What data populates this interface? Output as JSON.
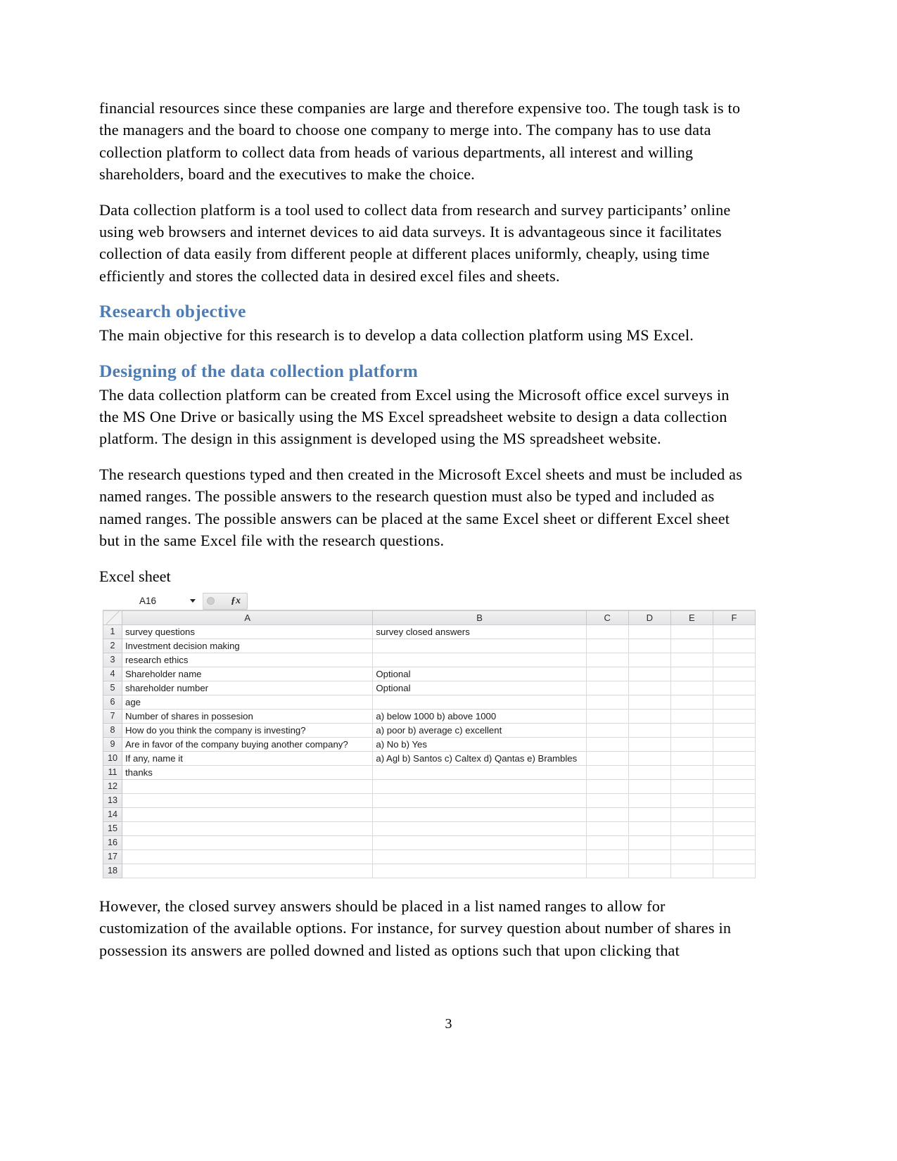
{
  "document": {
    "page_number": "3",
    "paragraphs": [
      "financial resources since these companies are large and therefore expensive too. The tough task is to the managers and the board to choose one company to merge into. The company has to use data collection platform to collect data from heads of various departments, all interest and willing shareholders, board and the executives to make the choice.",
      "Data collection platform is a tool used to collect data from research and survey participants’ online using web browsers and internet devices to aid data surveys.  It is advantageous since it facilitates collection of data easily from different people at different places uniformly, cheaply, using time efficiently and stores the collected data in desired excel files and sheets."
    ],
    "heading_1": "Research objective",
    "heading_1_body": "The main objective for this research is to develop a data collection platform using MS Excel.",
    "heading_2": "Designing of the data collection platform",
    "heading_2_body": "The data collection platform can be created from Excel using the Microsoft office excel surveys in the MS One Drive or basically using the MS Excel spreadsheet website to design a data collection platform. The design in this assignment is developed using the MS spreadsheet website.",
    "paragraph_after": "The research questions typed and then created in the Microsoft Excel sheets and must be included as named ranges. The possible answers to the research question must also be typed and included as named ranges. The possible answers can be placed at the same Excel sheet or different Excel sheet but in the same Excel file with the research questions.",
    "figure_caption": "Excel sheet",
    "closing_paragraph": "However, the closed survey answers should be placed in a list named ranges to allow for customization of the available options. For instance, for survey question about number of shares in possession its answers are polled downed and listed as options such that upon clicking that",
    "heading_color": "#4d7cb5"
  },
  "excel": {
    "name_box_value": "A16",
    "fx_label": "ƒx",
    "column_headers": [
      "A",
      "B",
      "C",
      "D",
      "E",
      "F"
    ],
    "rows": [
      {
        "num": "1",
        "a": "survey questions",
        "b": "survey closed answers"
      },
      {
        "num": "2",
        "a": "Investment decision making",
        "b": ""
      },
      {
        "num": "3",
        "a": "research ethics",
        "b": ""
      },
      {
        "num": "4",
        "a": "Shareholder name",
        "b": "Optional"
      },
      {
        "num": "5",
        "a": "shareholder number",
        "b": "Optional"
      },
      {
        "num": "6",
        "a": "age",
        "b": ""
      },
      {
        "num": "7",
        "a": "Number of shares in possesion",
        "b": "a) below 1000  b) above 1000"
      },
      {
        "num": "8",
        "a": "How do you think the company is investing?",
        "b": "a) poor b) average c) excellent"
      },
      {
        "num": "9",
        "a": "Are in favor of the company buying another company?",
        "b": "a) No   b) Yes"
      },
      {
        "num": "10",
        "a": "If any, name it",
        "b": "a) Agl b) Santos c) Caltex d) Qantas e) Brambles"
      },
      {
        "num": "11",
        "a": "thanks",
        "b": ""
      },
      {
        "num": "12",
        "a": "",
        "b": ""
      },
      {
        "num": "13",
        "a": "",
        "b": ""
      },
      {
        "num": "14",
        "a": "",
        "b": ""
      },
      {
        "num": "15",
        "a": "",
        "b": ""
      },
      {
        "num": "16",
        "a": "",
        "b": ""
      },
      {
        "num": "17",
        "a": "",
        "b": ""
      },
      {
        "num": "18",
        "a": "",
        "b": ""
      }
    ]
  }
}
